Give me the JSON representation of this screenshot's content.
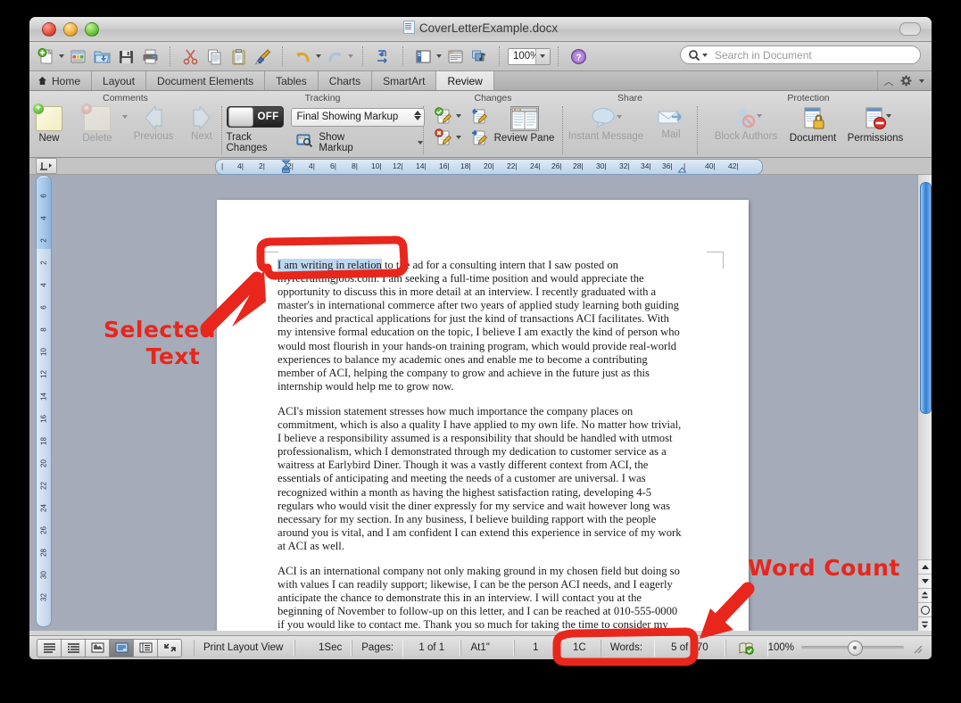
{
  "window": {
    "title": "CoverLetterExample.docx",
    "controls": {
      "close": "close",
      "minimize": "minimize",
      "zoom": "zoom"
    }
  },
  "toolbar": {
    "buttons": [
      {
        "name": "new-document",
        "icon": "new-doc-icon",
        "has_caret": true
      },
      {
        "name": "open-template-gallery",
        "icon": "template-gallery-icon",
        "has_caret": false
      },
      {
        "name": "open-file",
        "icon": "open-folder-icon",
        "has_caret": false
      },
      {
        "name": "save",
        "icon": "floppy-disk-icon",
        "has_caret": false
      },
      {
        "name": "print",
        "icon": "printer-icon",
        "has_caret": false
      },
      {
        "name": "cut",
        "icon": "scissors-icon",
        "has_caret": false
      },
      {
        "name": "copy",
        "icon": "copy-icon",
        "has_caret": false
      },
      {
        "name": "paste",
        "icon": "clipboard-icon",
        "has_caret": false
      },
      {
        "name": "format-painter",
        "icon": "paintbrush-icon",
        "has_caret": false
      },
      {
        "name": "undo",
        "icon": "undo-arrow-icon",
        "has_caret": true
      },
      {
        "name": "redo",
        "icon": "redo-arrow-icon",
        "has_caret": true
      },
      {
        "name": "show-formatting-marks",
        "icon": "pilcrow-arrows-icon",
        "has_caret": false
      },
      {
        "name": "sidebar-toggle",
        "icon": "sidebar-panel-icon",
        "has_caret": true
      },
      {
        "name": "show-toolbox",
        "icon": "toolbox-icon",
        "has_caret": false
      },
      {
        "name": "media-browser",
        "icon": "media-browser-icon",
        "has_caret": false
      }
    ],
    "zoom_value": "100%",
    "help_icon": "help-question-icon"
  },
  "search": {
    "icon": "magnifier-icon",
    "placeholder": "Search in Document",
    "value": ""
  },
  "ribbon_tabs": {
    "items": [
      {
        "label": "Home",
        "active": false,
        "icon": "home-icon"
      },
      {
        "label": "Layout",
        "active": false
      },
      {
        "label": "Document Elements",
        "active": false
      },
      {
        "label": "Tables",
        "active": false
      },
      {
        "label": "Charts",
        "active": false
      },
      {
        "label": "SmartArt",
        "active": false
      },
      {
        "label": "Review",
        "active": true
      }
    ],
    "collapse_icon": "chevron-up-icon",
    "settings_icon": "gear-icon"
  },
  "ribbon": {
    "groups": [
      {
        "title": "Comments",
        "buttons": [
          {
            "label": "New",
            "icon": "new-comment-icon",
            "enabled": true
          },
          {
            "label": "Delete",
            "icon": "delete-comment-icon",
            "enabled": false
          },
          {
            "label": "Previous",
            "icon": "previous-arrow-icon",
            "enabled": false
          },
          {
            "label": "Next",
            "icon": "next-arrow-icon",
            "enabled": false
          }
        ]
      },
      {
        "title": "Tracking",
        "track_changes_label": "Track Changes",
        "track_changes_state": "OFF",
        "markup_dropdown_value": "Final Showing Markup",
        "show_markup_label": "Show Markup",
        "show_markup_icon": "show-markup-icon"
      },
      {
        "title": "Changes",
        "accept_icon": "accept-change-icon",
        "reject_icon": "reject-change-icon",
        "previous_change_icon": "previous-change-icon",
        "next_change_icon": "next-change-icon",
        "review_pane_label": "Review Pane",
        "review_pane_icon": "review-pane-icon"
      },
      {
        "title": "Share",
        "buttons": [
          {
            "label": "Instant Message",
            "icon": "speech-balloon-icon",
            "enabled": false
          },
          {
            "label": "Mail",
            "icon": "envelope-icon",
            "enabled": false
          }
        ]
      },
      {
        "title": "Protection",
        "buttons": [
          {
            "label": "Block Authors",
            "icon": "block-author-icon",
            "enabled": false
          },
          {
            "label": "Document",
            "icon": "document-lock-icon",
            "enabled": true
          },
          {
            "label": "Permissions",
            "icon": "permissions-icon",
            "enabled": true
          }
        ]
      }
    ]
  },
  "ruler": {
    "horizontal_ticks": [
      "|",
      "4|",
      "2|",
      "2|",
      "4|",
      "6|",
      "8|",
      "10|",
      "12|",
      "14|",
      "16|",
      "18|",
      "20|",
      "22|",
      "24|",
      "26|",
      "28|",
      "30|",
      "32|",
      "34|",
      "36|",
      "|",
      "40|",
      "42|"
    ],
    "vertical_ticks": [
      "6",
      "4",
      "2",
      "2",
      "4",
      "6",
      "8",
      "10",
      "12",
      "14",
      "16",
      "18",
      "20",
      "22",
      "24",
      "26",
      "28",
      "30",
      "32"
    ],
    "corner_icon": "tab-selector-icon"
  },
  "document": {
    "selected_text": "I am writing in relation",
    "paragraphs": [
      {
        "selected_prefix": "I am writing in relation",
        "rest": " to the ad for a consulting intern that I saw posted on myrecruitingjobs.com. I am seeking a full-time position and would appreciate the opportunity to discuss this in more detail at an interview. I recently graduated with a master's in international commerce after two years of applied study learning both guiding theories and practical applications for just the kind of transactions ACI facilitates. With my intensive formal education on the topic, I believe I am exactly the kind of person who would most flourish in your hands-on training program, which would provide real-world experiences to balance my academic ones and enable me to become a contributing member of ACI, helping the company to grow and achieve in the future just as this internship would help me to grow now."
      },
      {
        "text": "ACI's mission statement stresses how much importance the company places on commitment, which is also a quality I have applied to my own life. No matter how trivial, I believe a responsibility assumed is a responsibility that should be handled with utmost professionalism, which I demonstrated through my dedication to customer service as a waitress at Earlybird Diner. Though it was a vastly different context from ACI, the essentials of anticipating and meeting the needs of a customer are universal. I was recognized within a month as having the highest satisfaction rating, developing 4-5 regulars who would visit the diner expressly for my service and wait however long was necessary for my section. In any business, I believe building rapport with the people around you is vital, and I am confident I can extend this experience in service of my work at ACI as well."
      },
      {
        "text": "ACI is an international company not only making ground in my chosen field but doing so with values I can readily support; likewise, I can be the person ACI needs, and I eagerly anticipate the chance to demonstrate this in an interview. I will contact you at the beginning of November to follow-up on this letter, and I can be reached at 010-555-0000 if you would like to contact me. Thank you so much for taking the time to consider my application, and I look forward to speaking with you further."
      }
    ]
  },
  "status_bar": {
    "view_buttons": [
      {
        "name": "draft-view",
        "icon": "draft-view-icon",
        "active": false
      },
      {
        "name": "outline-view",
        "icon": "outline-view-icon",
        "active": false
      },
      {
        "name": "publishing-layout-view",
        "icon": "publishing-view-icon",
        "active": false
      },
      {
        "name": "print-layout-view",
        "icon": "print-layout-icon",
        "active": true
      },
      {
        "name": "notebook-layout-view",
        "icon": "notebook-view-icon",
        "active": false
      },
      {
        "name": "full-screen-view",
        "icon": "fullscreen-icon",
        "active": false
      }
    ],
    "view_label": "Print Layout View",
    "section": "1Sec",
    "pages_label": "Pages:",
    "pages_value": "1 of 1",
    "at_value": "At1\"",
    "line_value": "1",
    "col_value": "1C",
    "words_label": "Words:",
    "words_value": "5 of 370",
    "spelling_icon": "spelling-check-icon",
    "zoom_percent": "100%",
    "resize_grip": "resize-grip-icon"
  },
  "annotations": [
    {
      "name": "selected-text-annotation",
      "text": "Selected\nText",
      "line1": "Selected",
      "line2": "Text",
      "color": "#e8261c"
    },
    {
      "name": "word-count-annotation",
      "text": "Word Count",
      "color": "#e8261c"
    }
  ],
  "colors": {
    "annotation_red": "#e8261c",
    "selection_blue": "#bed7f0",
    "workspace_gray": "#a5abb8",
    "scrollbar_blue": "#2f7fd4"
  }
}
